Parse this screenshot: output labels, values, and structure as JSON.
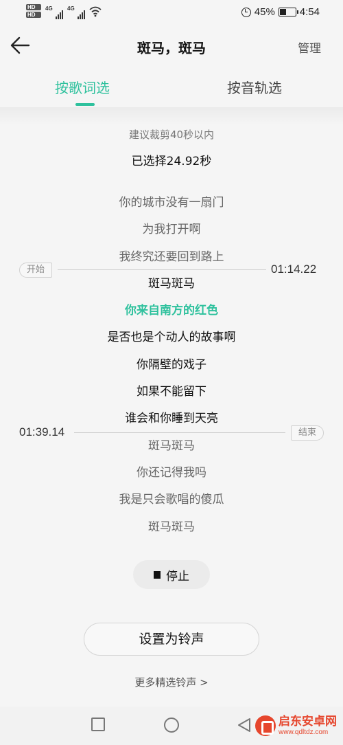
{
  "status_bar": {
    "hd_labels": [
      "HD",
      "HD"
    ],
    "network_1": "4G",
    "network_2": "4G",
    "battery_percent": "45%",
    "battery_level": 0.45,
    "time": "4:54",
    "icons": [
      "signal-icon",
      "wifi-icon",
      "alarm-icon",
      "battery-icon"
    ]
  },
  "header": {
    "title": "斑马，斑马",
    "manage_label": "管理"
  },
  "tabs": [
    {
      "label": "按歌词选",
      "active": true
    },
    {
      "label": "按音轨选",
      "active": false
    }
  ],
  "hint": "建议裁剪40秒以内",
  "selected_duration": "已选择24.92秒",
  "range": {
    "start_label": "开始",
    "start_time": "01:14.22",
    "end_label": "结束",
    "end_time": "01:39.14"
  },
  "lyrics": [
    {
      "text": "你的城市没有一扇门",
      "state": "outside"
    },
    {
      "text": "为我打开啊",
      "state": "outside"
    },
    {
      "text": "我终究还要回到路上",
      "state": "outside"
    },
    {
      "text": "斑马斑马",
      "state": "selected"
    },
    {
      "text": "你来自南方的红色",
      "state": "highlighted"
    },
    {
      "text": "是否也是个动人的故事啊",
      "state": "selected"
    },
    {
      "text": "你隔壁的戏子",
      "state": "selected"
    },
    {
      "text": "如果不能留下",
      "state": "selected"
    },
    {
      "text": "谁会和你睡到天亮",
      "state": "selected"
    },
    {
      "text": "斑马斑马",
      "state": "outside"
    },
    {
      "text": "你还记得我吗",
      "state": "outside"
    },
    {
      "text": "我是只会歌唱的傻瓜",
      "state": "outside"
    },
    {
      "text": "斑马斑马",
      "state": "outside"
    }
  ],
  "stop_label": "停止",
  "set_ringtone_label": "设置为铃声",
  "more_label": "更多精选铃声 >",
  "watermark": {
    "name": "启东安卓网",
    "url": "www.qdltdz.com"
  },
  "colors": {
    "accent": "#2ec19d",
    "background": "#f5f5f5",
    "watermark": "#e6462d"
  }
}
